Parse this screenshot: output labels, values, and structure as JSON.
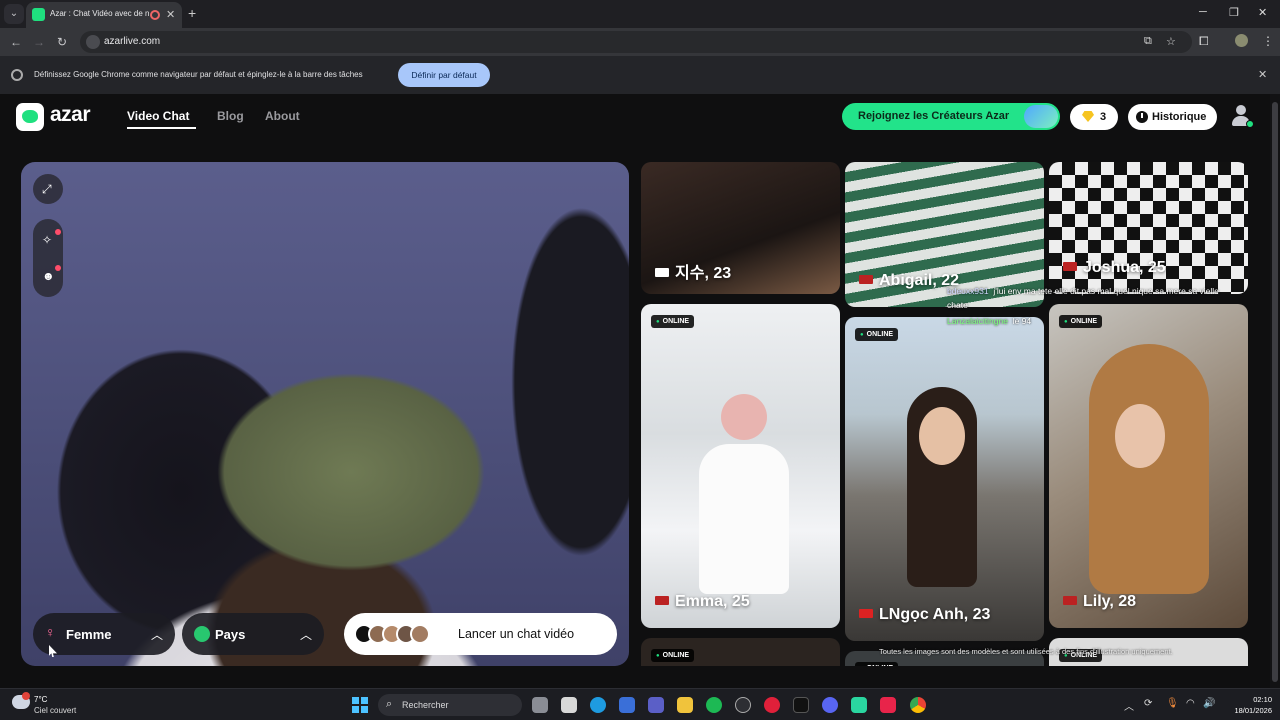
{
  "browser": {
    "tab_title": "Azar : Chat Vidéo avec de n",
    "url": "azarlive.com",
    "infobar_text": "Définissez Google Chrome comme navigateur par défaut et épinglez-le à la barre des tâches",
    "infobar_button": "Définir par défaut"
  },
  "header": {
    "logo_text": "azar",
    "nav": [
      "Video Chat",
      "Blog",
      "About"
    ],
    "creators_button": "Rejoignez les Créateurs Azar",
    "gems_count": "3",
    "history_button": "Historique"
  },
  "video_panel": {
    "gender_filter": "Femme",
    "country_filter": "Pays",
    "launch_button": "Lancer un chat vidéo"
  },
  "profiles": [
    {
      "name": "지수, 23",
      "online": false
    },
    {
      "name": "Abigail, 22",
      "online": false
    },
    {
      "name": "Joshua, 25",
      "online": false
    },
    {
      "name": "Emma, 25",
      "online": true
    },
    {
      "name": "LNgọc Anh, 23",
      "online": true
    },
    {
      "name": "Lily, 28",
      "online": true
    },
    {
      "name": "",
      "online": true
    },
    {
      "name": "",
      "online": true
    },
    {
      "name": "",
      "online": true
    }
  ],
  "online_label": "ONLINE",
  "overlay": {
    "chat_user": "bdeuxx931",
    "chat_message": "j'lui env ma tete elle dit pas mal quel nique sa mere sa vielle",
    "chat_message_2": "chate",
    "chat_user_2": "Lanzalaicitingne",
    "chat_message_3": "le 94",
    "disclaimer": "Toutes les images sont des modèles et sont utilisées à des fins d'illustration uniquement."
  },
  "taskbar": {
    "weather_temp": "7°C",
    "weather_desc": "Ciel couvert",
    "search_placeholder": "Rechercher",
    "time": "02:10",
    "date": "18/01/2026"
  },
  "colors": {
    "accent_green": "#1fe07f",
    "background": "#0f0f10",
    "infobar_button": "#a8c7fa"
  }
}
